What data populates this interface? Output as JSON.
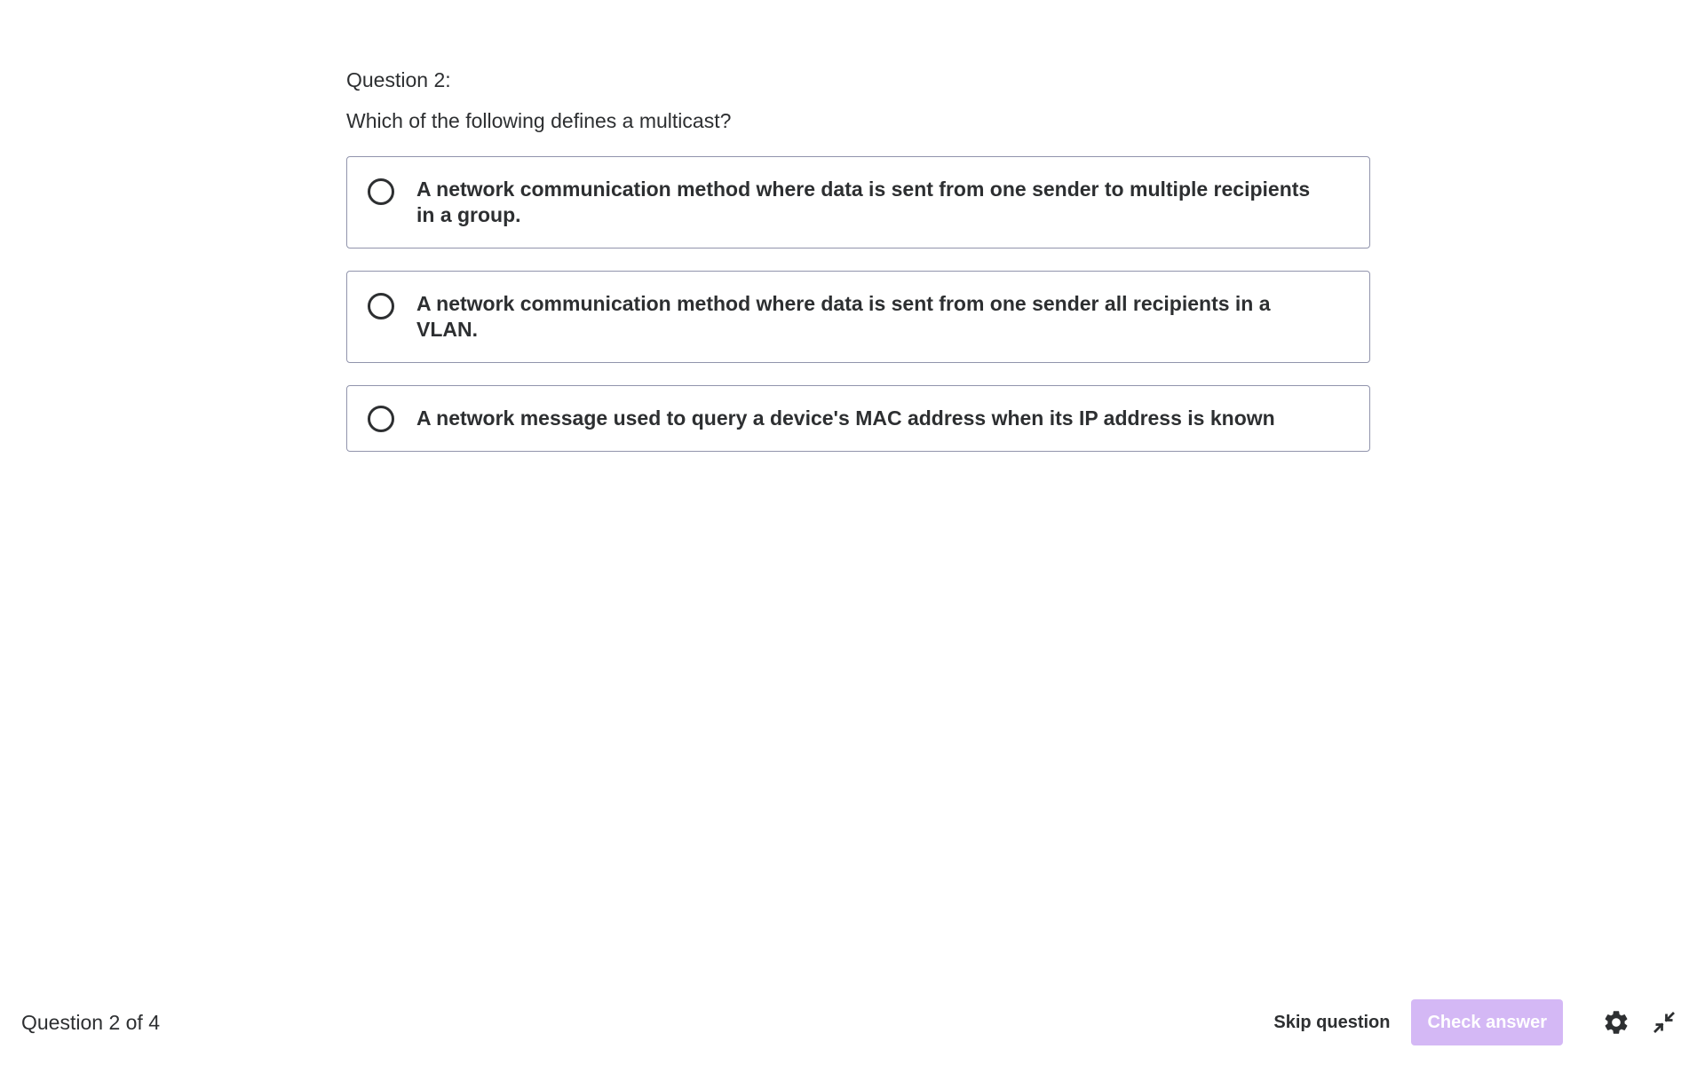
{
  "question": {
    "number_label": "Question 2:",
    "prompt": "Which of the following defines a multicast?",
    "options": [
      {
        "text": "A network communication method where data is sent from one sender to multiple recipients in a group."
      },
      {
        "text": "A network communication method where data is sent from one sender all recipients in a VLAN."
      },
      {
        "text": "A network message used to query a device's MAC address when its IP address is known"
      }
    ]
  },
  "footer": {
    "progress": "Question 2 of 4",
    "skip_label": "Skip question",
    "check_label": "Check answer",
    "settings_icon": "gear-icon",
    "collapse_icon": "collapse-icon"
  },
  "colors": {
    "text": "#2d2f31",
    "option_border": "#9194ac",
    "check_button_disabled": "#d4b8f5"
  }
}
